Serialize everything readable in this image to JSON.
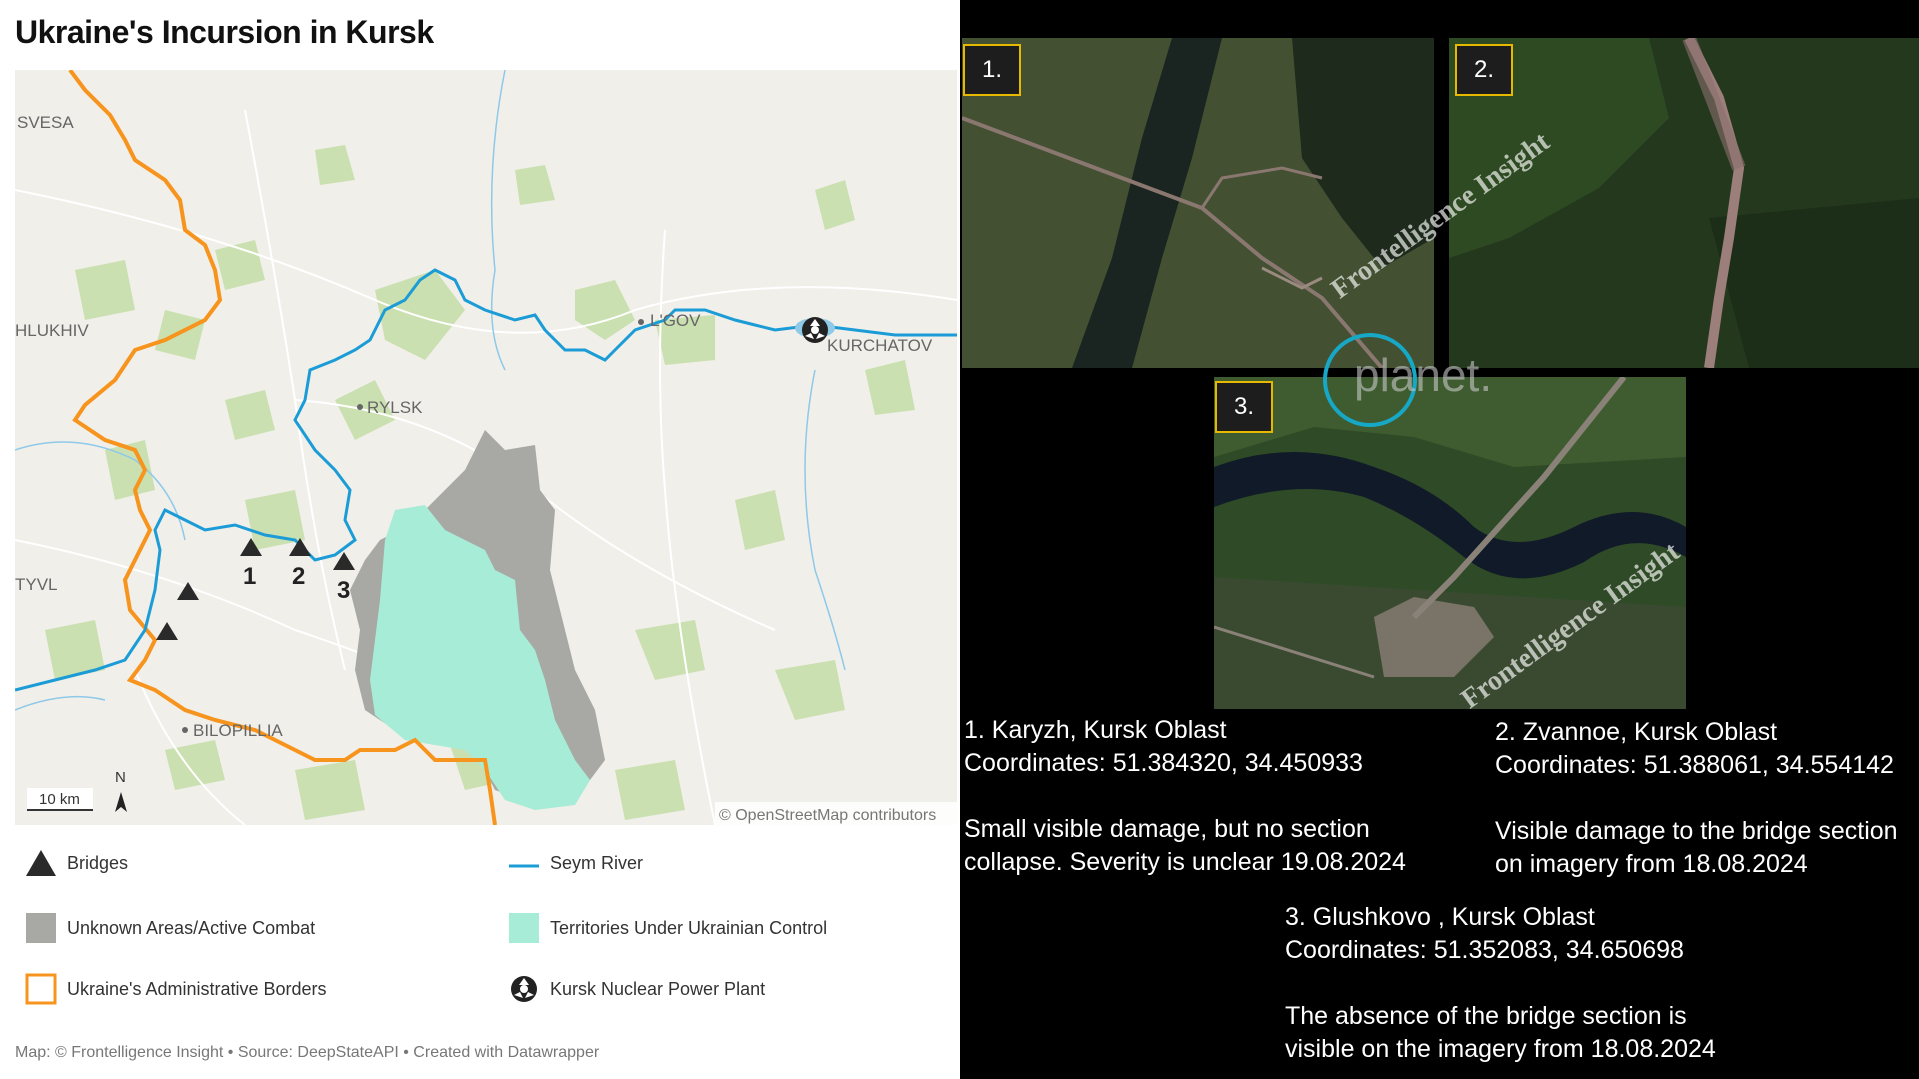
{
  "title": "Ukraine's Incursion in Kursk",
  "map": {
    "cities": {
      "svesa": "SVESA",
      "hlukhiv": "HLUKHIV",
      "lgov": "L'GOV",
      "kurchatov": "KURCHATOV",
      "rylsk": "RYLSK",
      "tyvl": "TYVL",
      "bilopillia": "BILOPILLIA"
    },
    "bridge_labels": [
      "1",
      "2",
      "3"
    ],
    "scale": "10 km",
    "north": "N",
    "attribution": "© OpenStreetMap contributors"
  },
  "legend": [
    {
      "label": "Bridges",
      "icon": "triangle-icon"
    },
    {
      "label": "Seym River",
      "icon": "river-line-icon"
    },
    {
      "label": "Unknown Areas/Active Combat",
      "icon": "gray-square-icon"
    },
    {
      "label": "Territories Under Ukrainian Control",
      "icon": "teal-square-icon"
    },
    {
      "label": "Ukraine's Administrative Borders",
      "icon": "orange-square-icon"
    },
    {
      "label": "Kursk Nuclear Power Plant",
      "icon": "radiation-icon"
    }
  ],
  "footer": "Map: © Frontelligence Insight • Source: DeepStateAPI • Created with Datawrapper",
  "colors": {
    "border": "#f7941d",
    "river": "#1b9cd6",
    "combat": "#a8a8a4",
    "ukr_control": "#a6ecd6",
    "map_bg": "#f0efea",
    "forest": "#cbe0b0",
    "badge_border": "#e6b800"
  },
  "panels": [
    {
      "badge": "1.",
      "watermark": ""
    },
    {
      "badge": "2.",
      "watermark": "Frontelligence Insight"
    },
    {
      "badge": "3.",
      "watermark": "Frontelligence Insight"
    }
  ],
  "logo": "planet.",
  "captions": [
    {
      "l1": "1. Karyzh, Kursk Oblast",
      "l2": "Coordinates: 51.384320, 34.450933",
      "l3": "Small visible damage, but no section",
      "l4": "collapse. Severity is unclear 19.08.2024"
    },
    {
      "l1": "2. Zvannoe, Kursk Oblast",
      "l2": "Coordinates: 51.388061, 34.554142",
      "l3": "Visible damage to the bridge section",
      "l4": "on imagery from 18.08.2024"
    },
    {
      "l1": "3. Glushkovo , Kursk Oblast",
      "l2": "Coordinates: 51.352083, 34.650698",
      "l3": "The absence of the bridge section is",
      "l4": "visible on the imagery from 18.08.2024"
    }
  ]
}
